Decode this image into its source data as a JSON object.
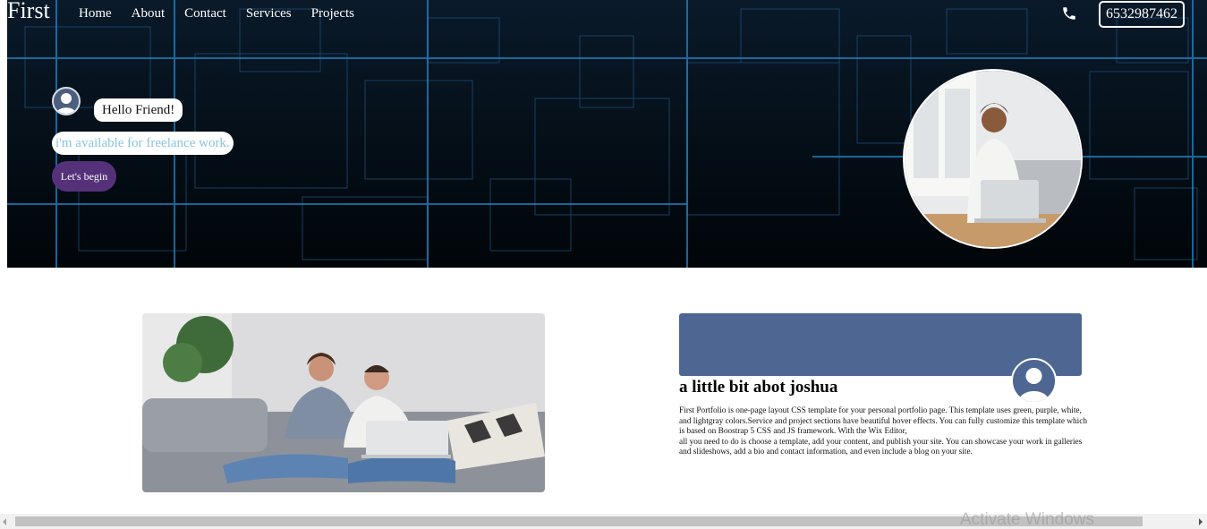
{
  "header": {
    "brand": "First",
    "nav": [
      "Home",
      "About",
      "Contact",
      "Services",
      "Projects"
    ],
    "phone": "6532987462",
    "phone_icon": "phone-icon"
  },
  "hero": {
    "greeting": "Hello Friend!",
    "availability": "i'm available for freelance work.",
    "cta": "Let's begin",
    "accent": "#55317a",
    "portrait_icon": "woman-on-laptop-photo"
  },
  "about": {
    "title": "a little bit abot joshua",
    "paragraph_1": "First Portfolio is one-page layout CSS template for your personal portfolio page. This template uses green, purple, white, and lightgray colors.Service and project sections have beautiful hover effects. You can fully customize this template which is based on Boostrap 5 CSS and JS framework. With the Wix Editor,",
    "paragraph_2": "all you need to do is choose a template, add your content, and publish your site. You can showcase your work in galleries and slideshows, add a bio and contact information, and even include a blog on your site.",
    "banner_color": "#4e6792"
  },
  "os": {
    "watermark": "Activate Windows"
  }
}
